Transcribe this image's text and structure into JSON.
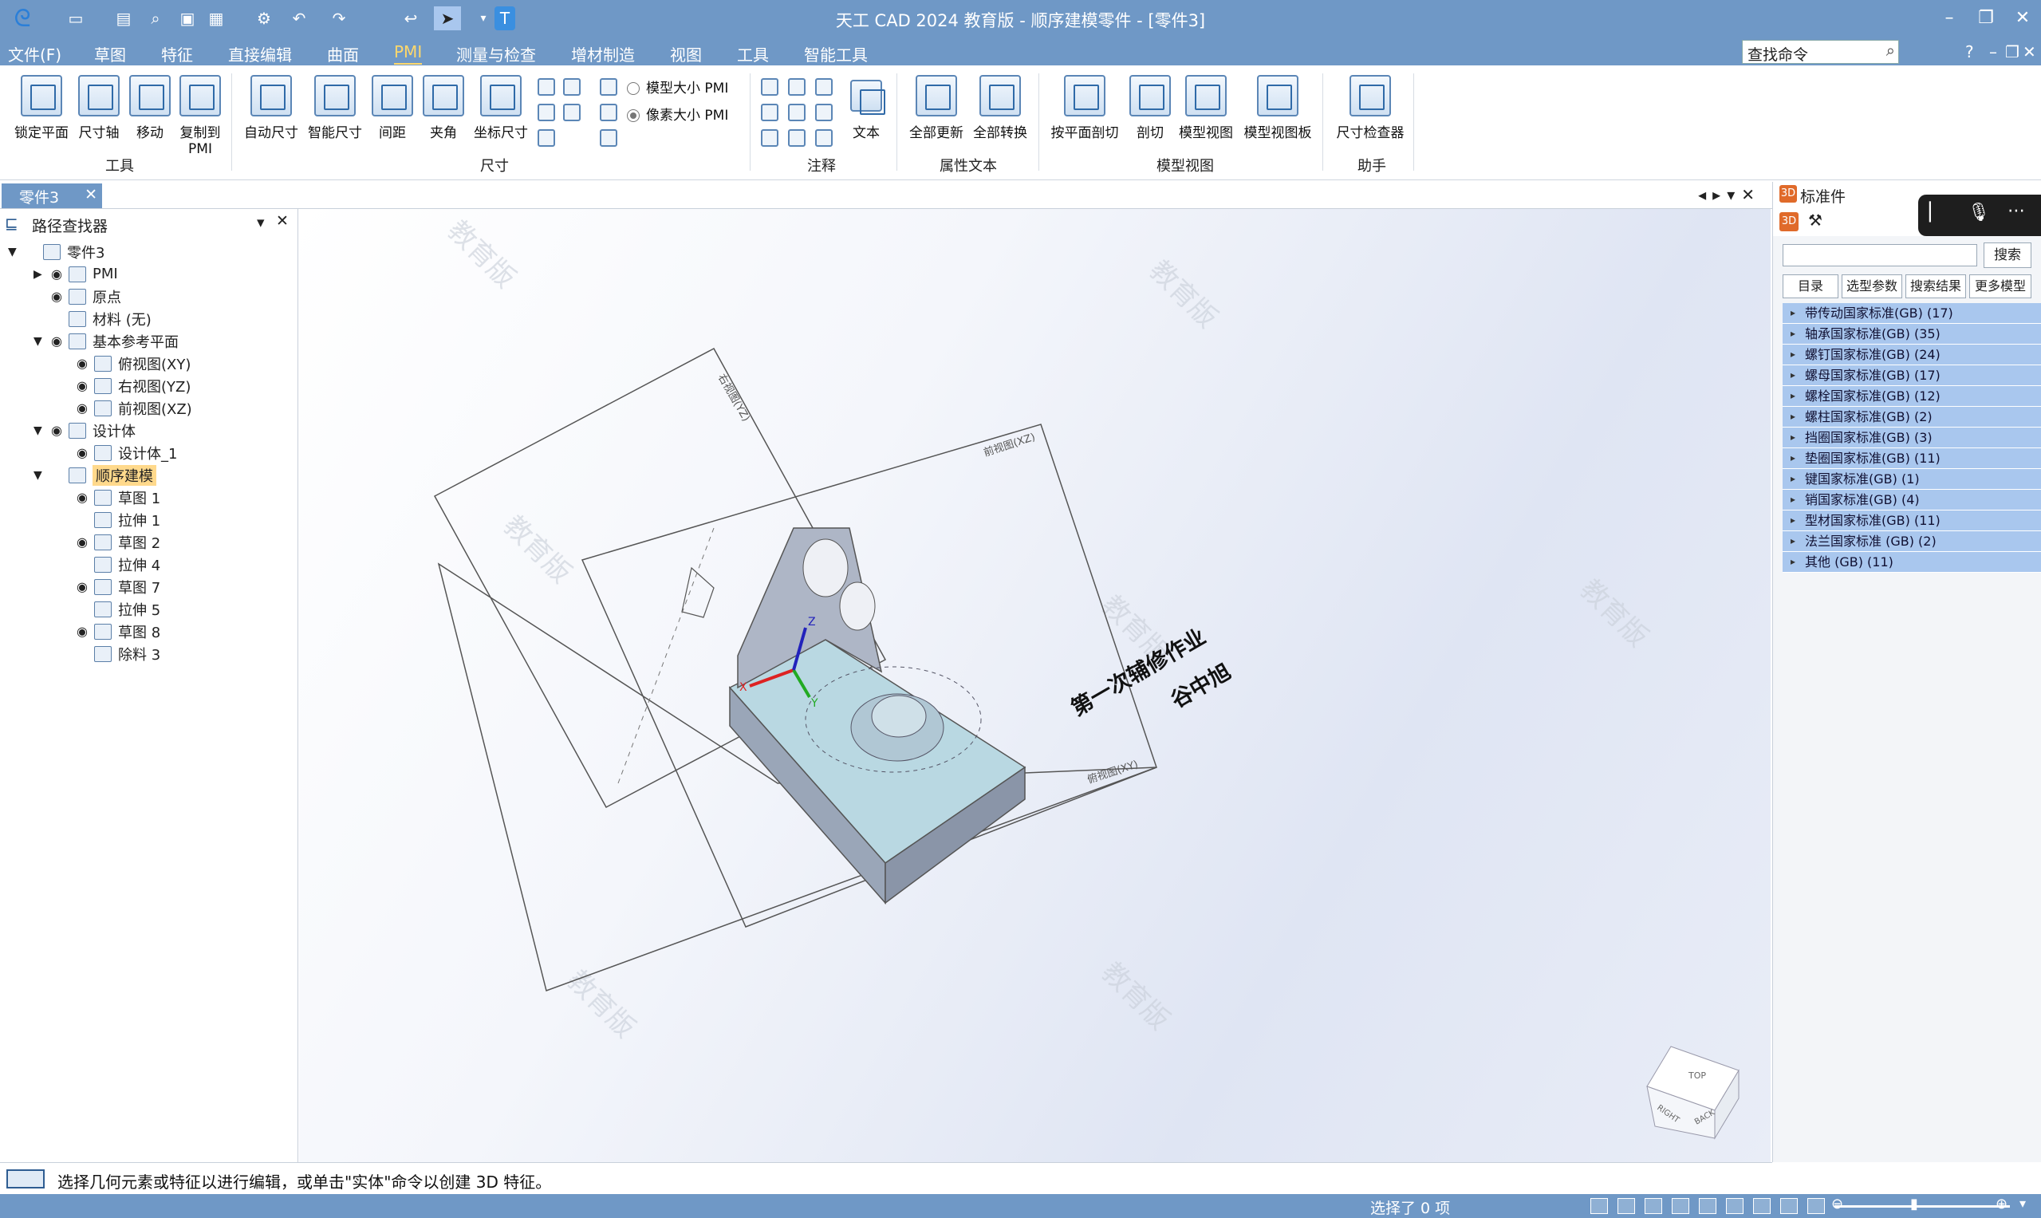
{
  "app": {
    "title": "天工 CAD 2024 教育版 - 顺序建模零件 - [零件3]",
    "window_controls": [
      "–",
      "❐",
      "✕"
    ]
  },
  "menubar": {
    "items": [
      "文件(F)",
      "草图",
      "特征",
      "直接编辑",
      "曲面",
      "PMI",
      "测量与检查",
      "增材制造",
      "视图",
      "工具",
      "智能工具"
    ],
    "active": "PMI",
    "search_placeholder": "查找命令",
    "right_icons": [
      "?",
      "–",
      "❐",
      "✕"
    ]
  },
  "ribbon": {
    "groups": [
      {
        "label": "工具",
        "buttons": [
          "锁定平面",
          "尺寸轴",
          "移动",
          "复制到PMI"
        ]
      },
      {
        "label": "尺寸",
        "buttons": [
          "自动尺寸",
          "智能尺寸",
          "间距",
          "夹角",
          "坐标尺寸"
        ]
      },
      {
        "label": "注释",
        "buttons": [
          "文本"
        ]
      },
      {
        "label": "属性文本",
        "buttons": [
          "全部更新",
          "全部转换"
        ]
      },
      {
        "label": "模型视图",
        "buttons": [
          "按平面剖切",
          "剖切",
          "模型视图",
          "模型视图板"
        ]
      },
      {
        "label": "助手",
        "buttons": [
          "尺寸检查器"
        ]
      }
    ],
    "radio_model_pmi": "模型大小 PMI",
    "radio_pixel_pmi": "像素大小 PMI",
    "radio_selected": "像素大小 PMI"
  },
  "document": {
    "tab_label": "零件3"
  },
  "path_finder": {
    "title": "路径查找器",
    "tree": [
      {
        "label": "零件3",
        "level": 0,
        "arrow": "▼",
        "eye": false
      },
      {
        "label": "PMI",
        "level": 1,
        "arrow": "▶",
        "eye": true
      },
      {
        "label": "原点",
        "level": 1,
        "arrow": "",
        "eye": true
      },
      {
        "label": "材料 (无)",
        "level": 1,
        "arrow": "",
        "eye": false
      },
      {
        "label": "基本参考平面",
        "level": 1,
        "arrow": "▼",
        "eye": true
      },
      {
        "label": "俯视图(XY)",
        "level": 2,
        "arrow": "",
        "eye": true
      },
      {
        "label": "右视图(YZ)",
        "level": 2,
        "arrow": "",
        "eye": true
      },
      {
        "label": "前视图(XZ)",
        "level": 2,
        "arrow": "",
        "eye": true
      },
      {
        "label": "设计体",
        "level": 1,
        "arrow": "▼",
        "eye": true
      },
      {
        "label": "设计体_1",
        "level": 2,
        "arrow": "",
        "eye": true
      },
      {
        "label": "顺序建模",
        "level": 1,
        "arrow": "▼",
        "eye": false,
        "highlight": true
      },
      {
        "label": "草图 1",
        "level": 2,
        "arrow": "",
        "eye": true
      },
      {
        "label": "拉伸 1",
        "level": 2,
        "arrow": "",
        "eye": false
      },
      {
        "label": "草图 2",
        "level": 2,
        "arrow": "",
        "eye": true
      },
      {
        "label": "拉伸 4",
        "level": 2,
        "arrow": "",
        "eye": false
      },
      {
        "label": "草图 7",
        "level": 2,
        "arrow": "",
        "eye": true
      },
      {
        "label": "拉伸 5",
        "level": 2,
        "arrow": "",
        "eye": false
      },
      {
        "label": "草图 8",
        "level": 2,
        "arrow": "",
        "eye": true
      },
      {
        "label": "除料 3",
        "level": 2,
        "arrow": "",
        "eye": false
      }
    ]
  },
  "viewport": {
    "plane_labels": [
      "右视图(YZ)",
      "前视图(XZ)",
      "俯视图(XY)"
    ],
    "annotation_line1": "第一次辅修作业",
    "annotation_line2": "谷中旭",
    "axis_labels": [
      "X",
      "Y",
      "Z"
    ],
    "watermark": "教育版",
    "viewcube_faces": [
      "TOP",
      "RIGHT",
      "BACK"
    ]
  },
  "standard_parts": {
    "title": "标准件",
    "search_button": "搜索",
    "tabs": [
      "目录",
      "选型参数",
      "搜索结果",
      "更多模型"
    ],
    "items": [
      "带传动国家标准(GB) (17)",
      "轴承国家标准(GB) (35)",
      "螺钉国家标准(GB) (24)",
      "螺母国家标准(GB) (17)",
      "螺栓国家标准(GB) (12)",
      "螺柱国家标准(GB) (2)",
      "挡圈国家标准(GB) (3)",
      "垫圈国家标准(GB) (11)",
      "键国家标准(GB) (1)",
      "销国家标准(GB) (4)",
      "型材国家标准(GB) (11)",
      "法兰国家标准 (GB) (2)",
      "其他 (GB) (11)"
    ]
  },
  "statusbar": {
    "message": "选择几何元素或特征以进行编辑，或单击\"实体\"命令以创建 3D 特征。",
    "selection_count": "选择了 0 项"
  },
  "colors": {
    "titlebar": "#6f98c6",
    "accent": "#ffd86b",
    "tree_highlight": "#ffd98c",
    "std_item": "#a9c7ee"
  }
}
